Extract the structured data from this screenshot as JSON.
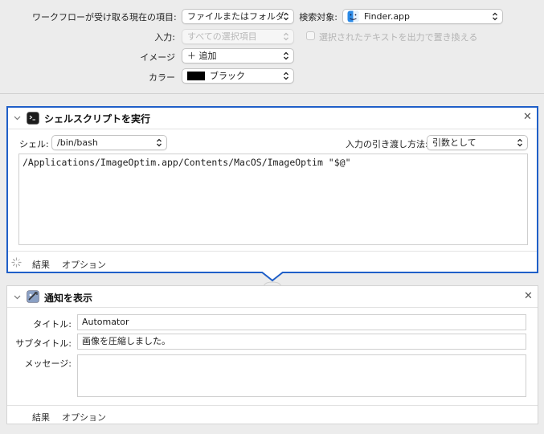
{
  "workflow": {
    "receives_label": "ワークフローが受け取る現在の項目:",
    "receives_value": "ファイルまたはフォルダ",
    "search_label": "検索対象:",
    "search_value": "Finder.app",
    "input_label": "入力:",
    "input_value": "すべての選択項目",
    "replace_checkbox_label": "選択されたテキストを出力で置き換える",
    "image_label": "イメージ",
    "image_value": "＋ 追加",
    "color_label": "カラー",
    "color_value": "ブラック",
    "color_swatch": "#000000"
  },
  "shell_action": {
    "title": "シェルスクリプトを実行",
    "shell_label": "シェル:",
    "shell_value": "/bin/bash",
    "pass_input_label": "入力の引き渡し方法:",
    "pass_input_value": "引数として",
    "script": "/Applications/ImageOptim.app/Contents/MacOS/ImageOptim \"$@\"",
    "results_label": "結果",
    "options_label": "オプション",
    "accent_color": "#1f5fc8"
  },
  "notify_action": {
    "title": "通知を表示",
    "title_label": "タイトル:",
    "title_value": "Automator",
    "subtitle_label": "サブタイトル:",
    "subtitle_value": "画像を圧縮しました。",
    "message_label": "メッセージ:",
    "message_value": "",
    "results_label": "結果",
    "options_label": "オプション"
  }
}
